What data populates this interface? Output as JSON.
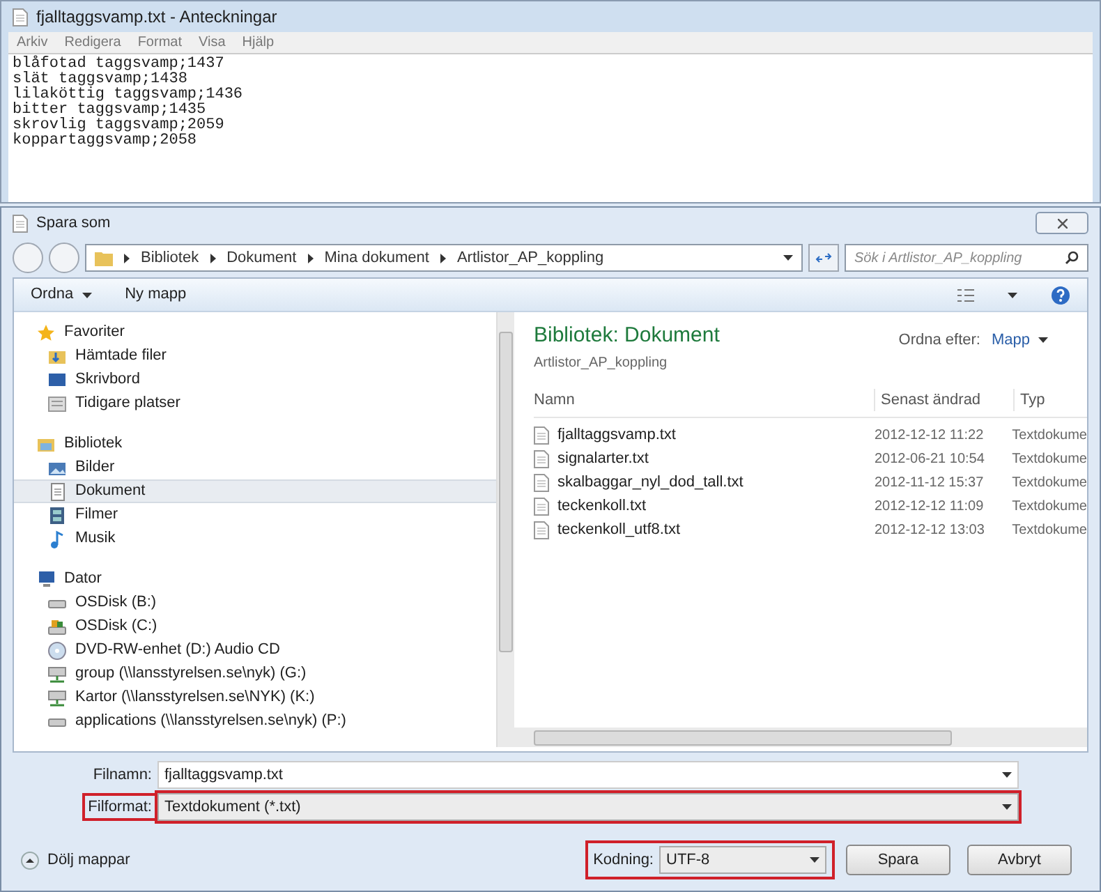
{
  "notepad": {
    "title": "fjalltaggsvamp.txt - Anteckningar",
    "menu": [
      "Arkiv",
      "Redigera",
      "Format",
      "Visa",
      "Hjälp"
    ],
    "lines": [
      "blåfotad taggsvamp;1437",
      "slät taggsvamp;1438",
      "lilaköttig taggsvamp;1436",
      "bitter taggsvamp;1435",
      "skrovlig taggsvamp;2059",
      "koppartaggsvamp;2058"
    ]
  },
  "dialog": {
    "title": "Spara som",
    "breadcrumb": [
      "Bibliotek",
      "Dokument",
      "Mina dokument",
      "Artlistor_AP_koppling"
    ],
    "search": {
      "placeholder": "Sök i Artlistor_AP_koppling"
    },
    "toolbar": [
      "Ordna",
      "Ny mapp"
    ],
    "nav": [
      {
        "label": "Favoriter",
        "kind": "star",
        "children": [
          {
            "label": "Hämtade filer",
            "kind": "download",
            "selected": false
          },
          {
            "label": "Skrivbord",
            "kind": "desktop",
            "selected": false
          },
          {
            "label": "Tidigare platser",
            "kind": "recent",
            "selected": false
          }
        ]
      },
      {
        "label": "Bibliotek",
        "kind": "library",
        "children": [
          {
            "label": "Bilder",
            "kind": "pictures",
            "selected": false
          },
          {
            "label": "Dokument",
            "kind": "document",
            "selected": true
          },
          {
            "label": "Filmer",
            "kind": "film",
            "selected": false
          },
          {
            "label": "Musik",
            "kind": "music",
            "selected": false
          }
        ]
      },
      {
        "label": "Dator",
        "kind": "computer",
        "children": [
          {
            "label": "OSDisk (B:)",
            "kind": "drive",
            "selected": false
          },
          {
            "label": "OSDisk (C:)",
            "kind": "system-drive",
            "selected": false
          },
          {
            "label": "DVD-RW-enhet (D:) Audio CD",
            "kind": "disc",
            "selected": false
          },
          {
            "label": "group (\\\\lansstyrelsen.se\\nyk) (G:)",
            "kind": "network",
            "selected": false
          },
          {
            "label": "Kartor (\\\\lansstyrelsen.se\\NYK) (K:)",
            "kind": "network",
            "selected": false
          },
          {
            "label": "applications (\\\\lansstyrelsen.se\\nyk) (P:)",
            "kind": "drive",
            "selected": false
          }
        ]
      }
    ],
    "library": {
      "title": "Bibliotek: Dokument",
      "subtitle": "Artlistor_AP_koppling",
      "sort_label": "Ordna efter:",
      "sort_value": "Mapp"
    },
    "columns": [
      "Namn",
      "Senast ändrad",
      "Typ"
    ],
    "files": [
      {
        "name": "fjalltaggsvamp.txt",
        "date": "2012-12-12 11:22",
        "type": "Textdokume"
      },
      {
        "name": "signalarter.txt",
        "date": "2012-06-21 10:54",
        "type": "Textdokume"
      },
      {
        "name": "skalbaggar_nyl_dod_tall.txt",
        "date": "2012-11-12 15:37",
        "type": "Textdokume"
      },
      {
        "name": "teckenkoll.txt",
        "date": "2012-12-12 11:09",
        "type": "Textdokume"
      },
      {
        "name": "teckenkoll_utf8.txt",
        "date": "2012-12-12 13:03",
        "type": "Textdokume"
      }
    ],
    "filename": {
      "label": "Filnamn:",
      "value": "fjalltaggsvamp.txt"
    },
    "filetype": {
      "label": "Filformat:",
      "value": "Textdokument (*.txt)",
      "highlighted": true
    },
    "encoding": {
      "label": "Kodning:",
      "value": "UTF-8",
      "highlighted": true
    },
    "hide_folders": "Dölj mappar",
    "buttons": [
      "Spara",
      "Avbryt"
    ]
  }
}
